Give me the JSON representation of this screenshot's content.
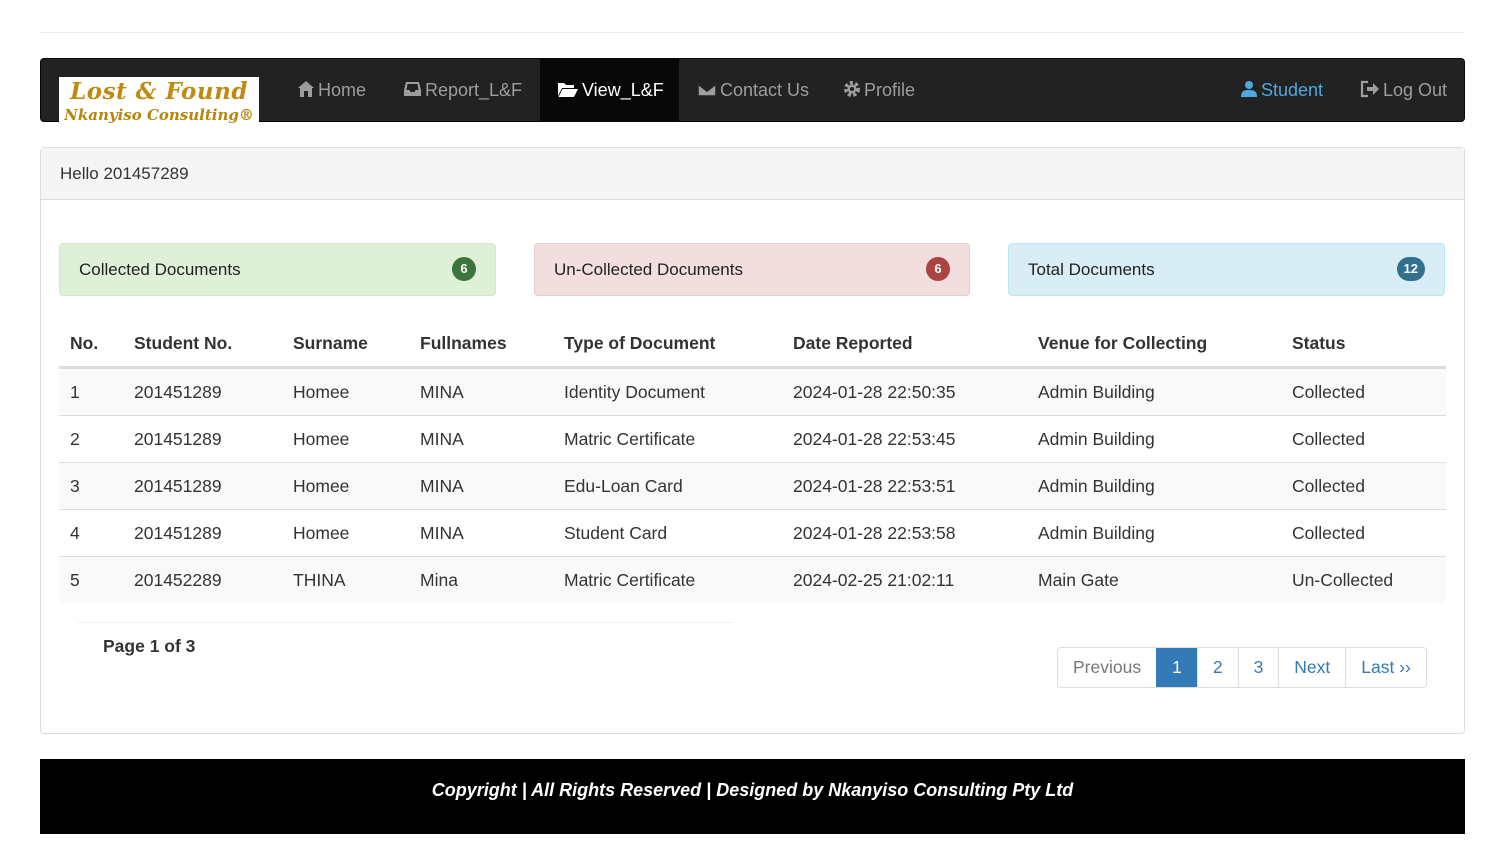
{
  "brand": {
    "line1": "Lost & Found",
    "line2": "Nkanyiso Consulting®"
  },
  "nav": {
    "home": "Home",
    "report": "Report_L&F",
    "view": "View_L&F",
    "contact": "Contact Us",
    "profile": "Profile",
    "student": "Student",
    "logout": "Log Out"
  },
  "panel": {
    "greeting": "Hello 201457289"
  },
  "stats": {
    "collected": {
      "label": "Collected Documents",
      "count": "6"
    },
    "uncollected": {
      "label": "Un-Collected Documents",
      "count": "6"
    },
    "total": {
      "label": "Total Documents",
      "count": "12"
    }
  },
  "table": {
    "headers": [
      "No.",
      "Student No.",
      "Surname",
      "Fullnames",
      "Type of Document",
      "Date Reported",
      "Venue for Collecting",
      "Status"
    ],
    "rows": [
      [
        "1",
        "201451289",
        "Homee",
        "MINA",
        "Identity Document",
        "2024-01-28 22:50:35",
        "Admin Building",
        "Collected"
      ],
      [
        "2",
        "201451289",
        "Homee",
        "MINA",
        "Matric Certificate",
        "2024-01-28 22:53:45",
        "Admin Building",
        "Collected"
      ],
      [
        "3",
        "201451289",
        "Homee",
        "MINA",
        "Edu-Loan Card",
        "2024-01-28 22:53:51",
        "Admin Building",
        "Collected"
      ],
      [
        "4",
        "201451289",
        "Homee",
        "MINA",
        "Student Card",
        "2024-01-28 22:53:58",
        "Admin Building",
        "Collected"
      ],
      [
        "5",
        "201452289",
        "THINA",
        "Mina",
        "Matric Certificate",
        "2024-02-25 21:02:11",
        "Main Gate",
        "Un-Collected"
      ]
    ]
  },
  "pagination": {
    "info": "Page 1 of 3",
    "previous": "Previous",
    "pages": [
      "1",
      "2",
      "3"
    ],
    "next": "Next",
    "last": "Last ››"
  },
  "footer": {
    "text": "Copyright | All Rights Reserved | Designed by Nkanyiso Consulting Pty Ltd"
  },
  "colors": {
    "navbar": "#222222",
    "success": "#3c763d",
    "danger": "#a94442",
    "info": "#31708f",
    "primary": "#337ab7"
  },
  "icons": {
    "home": "home-icon",
    "report": "inbox-icon",
    "view": "folder-open-icon",
    "contact": "envelope-icon",
    "profile": "gear-icon",
    "student": "user-icon",
    "logout": "log-out-icon"
  }
}
